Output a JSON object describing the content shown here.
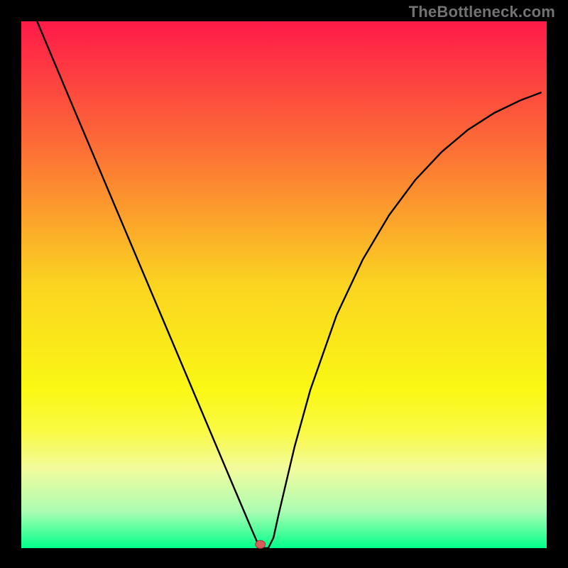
{
  "watermark": "TheBottleneck.com",
  "chart_data": {
    "type": "line",
    "title": "",
    "xlabel": "",
    "ylabel": "",
    "xlim": [
      0,
      100
    ],
    "ylim": [
      0,
      100
    ],
    "grid": false,
    "legend": false,
    "series": [
      {
        "name": "curve",
        "x": [
          3.0,
          10,
          20,
          30,
          40,
          42,
          44,
          45,
          45.5,
          47,
          48,
          49,
          52,
          55,
          60,
          65,
          70,
          75,
          80,
          85,
          90,
          95,
          99
        ],
        "values": [
          100,
          83.4,
          59.8,
          36.2,
          12.6,
          7.9,
          3.2,
          0.9,
          0.0,
          0.0,
          2.0,
          6.5,
          19.2,
          30.0,
          44.2,
          54.8,
          63.2,
          69.9,
          75.2,
          79.4,
          82.6,
          85.0,
          86.5
        ]
      }
    ],
    "marker": {
      "x": 45.5,
      "y": 0.7
    },
    "background_gradient": {
      "stops": [
        {
          "pct": 0,
          "color": "#fe1a49"
        },
        {
          "pct": 25,
          "color": "#fc7235"
        },
        {
          "pct": 50,
          "color": "#fbd421"
        },
        {
          "pct": 70,
          "color": "#faf814"
        },
        {
          "pct": 78,
          "color": "#f9fa46"
        },
        {
          "pct": 85,
          "color": "#f2fb9e"
        },
        {
          "pct": 93,
          "color": "#abfdb2"
        },
        {
          "pct": 97,
          "color": "#4bfe9b"
        },
        {
          "pct": 100,
          "color": "#01ff8b"
        }
      ]
    },
    "colors": {
      "frame": "#000000",
      "curve": "#000000",
      "marker_fill": "#d85a5a",
      "marker_stroke": "#9c3a3a"
    }
  }
}
